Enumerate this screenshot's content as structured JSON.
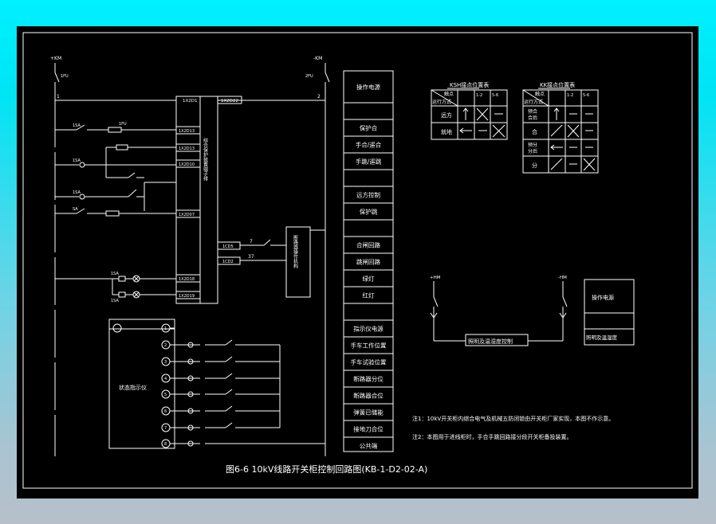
{
  "caption": "图6-6 10kV线路开关柜控制回路图(KB-1-D2-02-A)",
  "bus": {
    "left_label": "+KM",
    "right_label": "-KM",
    "left_fuse": "1FU",
    "right_fuse": "2FU",
    "left_node": "1",
    "right_node": "2"
  },
  "protection_device": {
    "label": "综合保护装置端子排",
    "terminals_top": [
      "1X2D1",
      "1X2D22"
    ],
    "terminals_left": [
      "1X2D13",
      "1X2D13",
      "1X2D10",
      "1X2D07",
      "1X2D18",
      "1X2D19"
    ],
    "terminals_right": [
      "1CD5",
      "1CD2"
    ],
    "wire_7": "7",
    "wire_37": "37"
  },
  "breaker_mechanism": {
    "label": "断路器操作机构"
  },
  "left_labels": [
    "1SA",
    "1FU",
    "1SA",
    "1SA",
    "SA",
    "1SA",
    "1SA"
  ],
  "status_indicator": {
    "label": "状态指示仪",
    "rows": [
      "1",
      "2",
      "3",
      "4",
      "5",
      "6",
      "7",
      "8"
    ]
  },
  "right_column": [
    "操作电源",
    "",
    "保护合",
    "手合/遥合",
    "手跳/遥跳",
    "",
    "远方控制",
    "保护跳",
    "",
    "合闸回路",
    "跳闸回路",
    "绿灯",
    "红灯",
    "",
    "指示仪电源",
    "手车工作位置",
    "手车试验位置",
    "断路器分位",
    "断路器合位",
    "弹簧已储能",
    "接地刀合位",
    "公共端"
  ],
  "ksh_table": {
    "title": "KSH接点位置表",
    "header_row": "运行方式",
    "header_col": "触点",
    "contacts": [
      "1-2",
      "5-6"
    ],
    "rows": [
      {
        "label": "远方",
        "cells": [
          "",
          "X",
          "—"
        ]
      },
      {
        "label": "就地",
        "cells": [
          "",
          "—",
          "X"
        ]
      }
    ]
  },
  "kk_table": {
    "title": "KK接点位置表",
    "header_row": "运行方式",
    "header_col": "触点",
    "contacts": [
      "1-2",
      "5-6"
    ],
    "rows": [
      {
        "label": "预合\n合后",
        "cells": [
          "",
          "—",
          "—"
        ]
      },
      {
        "label": "合",
        "cells": [
          "",
          "X",
          "—"
        ]
      },
      {
        "label": "预分\n分后",
        "cells": [
          "",
          "—",
          "—"
        ]
      },
      {
        "label": "分",
        "cells": [
          "",
          "—",
          "X"
        ]
      }
    ]
  },
  "lighting": {
    "left": "+HM",
    "right": "-HM",
    "box": "照明及温湿度控制",
    "legend_top": "操作电源",
    "legend_bottom": "照明及温湿度"
  },
  "notes": [
    "注1：10kV开关柜内综合电气及机械五防闭锁由开关柜厂家实现，本图不作示意。",
    "注2：本图用于进线柜时，手合手跳回路接分段开关柜备投装置。"
  ]
}
